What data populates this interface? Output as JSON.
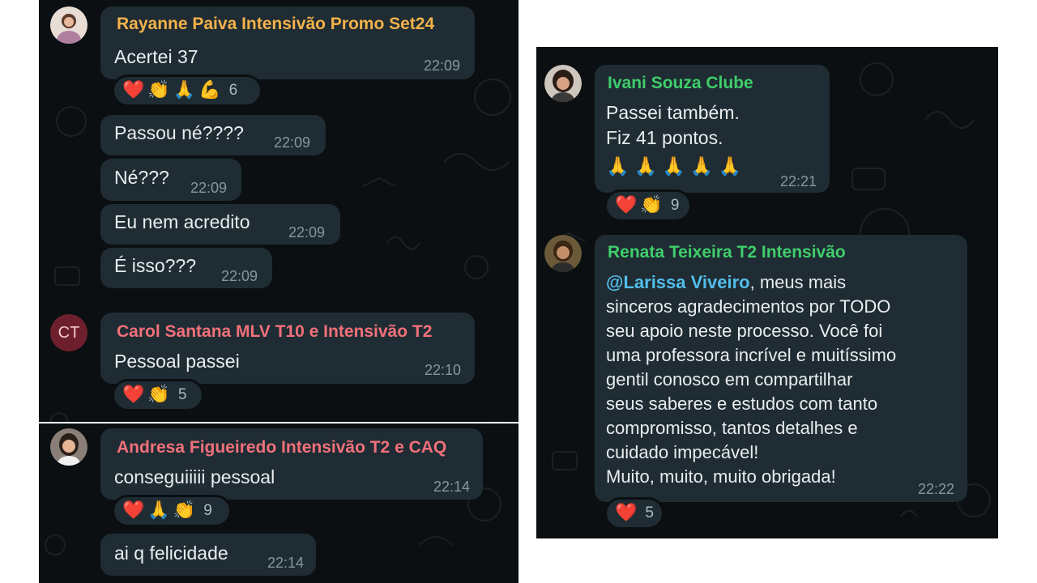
{
  "colors": {
    "panel_bg": "#0b0f12",
    "bubble_bg": "#1f2c33",
    "sender_pink": "#f4b24b",
    "sender_salmon": "#f2707a",
    "sender_green": "#3fce6b",
    "mention": "#53bdeb",
    "timestamp": "#8696a0"
  },
  "left": {
    "msgs": [
      {
        "sender": "Rayanne Paiva Intensivão Promo Set24",
        "text": "Acertei 37",
        "time": "22:09",
        "reactions": [
          "❤️",
          "👏",
          "🙏",
          "💪"
        ],
        "count": "6"
      },
      {
        "text": "Passou né????",
        "time": "22:09"
      },
      {
        "text": "Né???",
        "time": "22:09"
      },
      {
        "text": "Eu nem acredito",
        "time": "22:09"
      },
      {
        "text": "É isso???",
        "time": "22:09"
      },
      {
        "sender": "Carol Santana MLV T10 e Intensivão T2",
        "avatar_initials": "CT",
        "text": "Pessoal passei",
        "time": "22:10",
        "reactions": [
          "❤️",
          "👏"
        ],
        "count": "5"
      },
      {
        "sender": "Andresa Figueiredo Intensivão T2 e CAQ",
        "text": "conseguiiiii pessoal",
        "time": "22:14",
        "reactions": [
          "❤️",
          "🙏",
          "👏"
        ],
        "count": "9"
      },
      {
        "text": "ai q felicidade",
        "time": "22:14"
      }
    ]
  },
  "right": {
    "msg1": {
      "sender": "Ivani Souza Clube",
      "line1": "Passei também.",
      "line2": "Fiz 41 pontos.",
      "emoji_line": "🙏🙏🙏🙏🙏",
      "time": "22:21",
      "reactions": [
        "❤️",
        "👏"
      ],
      "count": "9"
    },
    "msg2": {
      "sender": "Renata Teixeira T2 Intensivão",
      "mention": "@Larissa Viveiro",
      "text_first": ", meus mais",
      "text_rest": "sinceros agradecimentos por TODO\nseu apoio neste  processo. Você foi\numa professora incrível e muitíssimo\ngentil conosco em compartilhar\nseus saberes e estudos com  tanto\ncompromisso, tantos detalhes e\ncuidado impecável!\nMuito, muito, muito obrigada!",
      "time": "22:22",
      "reactions": [
        "❤️"
      ],
      "count": "5"
    }
  }
}
